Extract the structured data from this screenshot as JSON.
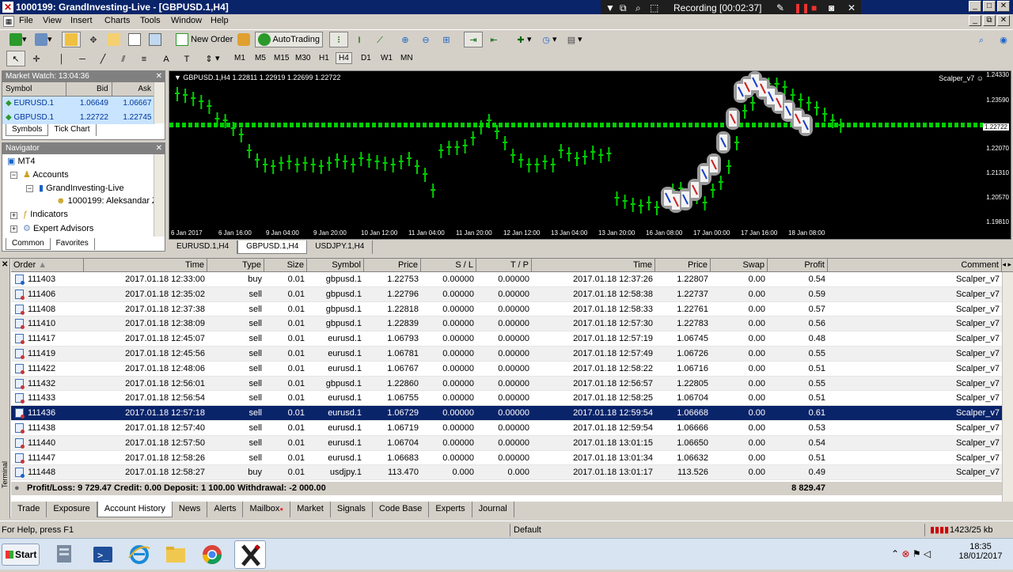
{
  "window": {
    "title": "1000199: GrandInvesting-Live - [GBPUSD.1,H4]"
  },
  "recorder": {
    "label": "Recording [00:02:37]"
  },
  "menu": [
    "File",
    "View",
    "Insert",
    "Charts",
    "Tools",
    "Window",
    "Help"
  ],
  "toolbar": {
    "new_order": "New Order",
    "autotrading": "AutoTrading"
  },
  "timeframes": [
    "M1",
    "M5",
    "M15",
    "M30",
    "H1",
    "H4",
    "D1",
    "W1",
    "MN"
  ],
  "timeframe_active": "H4",
  "market_watch": {
    "title": "Market Watch: 13:04:36",
    "headers": {
      "symbol": "Symbol",
      "bid": "Bid",
      "ask": "Ask"
    },
    "rows": [
      {
        "symbol": "EURUSD.1",
        "bid": "1.06649",
        "ask": "1.06667"
      },
      {
        "symbol": "GBPUSD.1",
        "bid": "1.22722",
        "ask": "1.22745"
      }
    ],
    "tabs": [
      "Symbols",
      "Tick Chart"
    ]
  },
  "navigator": {
    "title": "Navigator",
    "items": {
      "root": "MT4",
      "accounts": "Accounts",
      "server": "GrandInvesting-Live",
      "account": "1000199: Aleksandar Z",
      "indicators": "Indicators",
      "experts": "Expert Advisors"
    },
    "tabs": [
      "Common",
      "Favorites"
    ]
  },
  "chart": {
    "ohlc_label": "GBPUSD.1,H4  1.22811 1.22919 1.22699 1.22722",
    "ea_label": "Scalper_v7",
    "price_labels": [
      "1.24330",
      "1.23590",
      "1.22722",
      "1.22070",
      "1.21310",
      "1.20570",
      "1.19810"
    ],
    "time_labels": [
      "6 Jan 2017",
      "6 Jan 16:00",
      "9 Jan 04:00",
      "9 Jan 20:00",
      "10 Jan 12:00",
      "11 Jan 04:00",
      "11 Jan 20:00",
      "12 Jan 12:00",
      "13 Jan 04:00",
      "13 Jan 20:00",
      "16 Jan 08:00",
      "17 Jan 00:00",
      "17 Jan 16:00",
      "18 Jan 08:00"
    ],
    "tabs": [
      "EURUSD.1,H4",
      "GBPUSD.1,H4",
      "USDJPY.1,H4"
    ],
    "active_tab": "GBPUSD.1,H4"
  },
  "terminal": {
    "side_label": "Terminal",
    "headers": [
      "Order",
      "Time",
      "Type",
      "Size",
      "Symbol",
      "Price",
      "S / L",
      "T / P",
      "Time",
      "Price",
      "Swap",
      "Profit",
      "Comment"
    ],
    "rows": [
      [
        "111403",
        "2017.01.18 12:33:00",
        "buy",
        "0.01",
        "gbpusd.1",
        "1.22753",
        "0.00000",
        "0.00000",
        "2017.01.18 12:37:26",
        "1.22807",
        "0.00",
        "0.54",
        "Scalper_v7"
      ],
      [
        "111406",
        "2017.01.18 12:35:02",
        "sell",
        "0.01",
        "gbpusd.1",
        "1.22796",
        "0.00000",
        "0.00000",
        "2017.01.18 12:58:38",
        "1.22737",
        "0.00",
        "0.59",
        "Scalper_v7"
      ],
      [
        "111408",
        "2017.01.18 12:37:38",
        "sell",
        "0.01",
        "gbpusd.1",
        "1.22818",
        "0.00000",
        "0.00000",
        "2017.01.18 12:58:33",
        "1.22761",
        "0.00",
        "0.57",
        "Scalper_v7"
      ],
      [
        "111410",
        "2017.01.18 12:38:09",
        "sell",
        "0.01",
        "gbpusd.1",
        "1.22839",
        "0.00000",
        "0.00000",
        "2017.01.18 12:57:30",
        "1.22783",
        "0.00",
        "0.56",
        "Scalper_v7"
      ],
      [
        "111417",
        "2017.01.18 12:45:07",
        "sell",
        "0.01",
        "eurusd.1",
        "1.06793",
        "0.00000",
        "0.00000",
        "2017.01.18 12:57:19",
        "1.06745",
        "0.00",
        "0.48",
        "Scalper_v7"
      ],
      [
        "111419",
        "2017.01.18 12:45:56",
        "sell",
        "0.01",
        "eurusd.1",
        "1.06781",
        "0.00000",
        "0.00000",
        "2017.01.18 12:57:49",
        "1.06726",
        "0.00",
        "0.55",
        "Scalper_v7"
      ],
      [
        "111422",
        "2017.01.18 12:48:06",
        "sell",
        "0.01",
        "eurusd.1",
        "1.06767",
        "0.00000",
        "0.00000",
        "2017.01.18 12:58:22",
        "1.06716",
        "0.00",
        "0.51",
        "Scalper_v7"
      ],
      [
        "111432",
        "2017.01.18 12:56:01",
        "sell",
        "0.01",
        "gbpusd.1",
        "1.22860",
        "0.00000",
        "0.00000",
        "2017.01.18 12:56:57",
        "1.22805",
        "0.00",
        "0.55",
        "Scalper_v7"
      ],
      [
        "111433",
        "2017.01.18 12:56:54",
        "sell",
        "0.01",
        "eurusd.1",
        "1.06755",
        "0.00000",
        "0.00000",
        "2017.01.18 12:58:25",
        "1.06704",
        "0.00",
        "0.51",
        "Scalper_v7"
      ],
      [
        "111436",
        "2017.01.18 12:57:18",
        "sell",
        "0.01",
        "eurusd.1",
        "1.06729",
        "0.00000",
        "0.00000",
        "2017.01.18 12:59:54",
        "1.06668",
        "0.00",
        "0.61",
        "Scalper_v7"
      ],
      [
        "111438",
        "2017.01.18 12:57:40",
        "sell",
        "0.01",
        "eurusd.1",
        "1.06719",
        "0.00000",
        "0.00000",
        "2017.01.18 12:59:54",
        "1.06666",
        "0.00",
        "0.53",
        "Scalper_v7"
      ],
      [
        "111440",
        "2017.01.18 12:57:50",
        "sell",
        "0.01",
        "eurusd.1",
        "1.06704",
        "0.00000",
        "0.00000",
        "2017.01.18 13:01:15",
        "1.06650",
        "0.00",
        "0.54",
        "Scalper_v7"
      ],
      [
        "111447",
        "2017.01.18 12:58:26",
        "sell",
        "0.01",
        "eurusd.1",
        "1.06683",
        "0.00000",
        "0.00000",
        "2017.01.18 13:01:34",
        "1.06632",
        "0.00",
        "0.51",
        "Scalper_v7"
      ],
      [
        "111448",
        "2017.01.18 12:58:27",
        "buy",
        "0.01",
        "usdjpy.1",
        "113.470",
        "0.000",
        "0.000",
        "2017.01.18 13:01:17",
        "113.526",
        "0.00",
        "0.49",
        "Scalper_v7"
      ]
    ],
    "selected_row": 9,
    "summary": "Profit/Loss: 9 729.47  Credit: 0.00  Deposit: 1 100.00  Withdrawal: -2 000.00",
    "summary_total": "8 829.47",
    "tabs": [
      "Trade",
      "Exposure",
      "Account History",
      "News",
      "Alerts",
      "Mailbox",
      "Market",
      "Signals",
      "Code Base",
      "Experts",
      "Journal"
    ],
    "active_tab": "Account History"
  },
  "status": {
    "help": "For Help, press F1",
    "profile": "Default",
    "traffic": "1423/25 kb"
  },
  "taskbar": {
    "start": "Start",
    "time": "18:35",
    "date": "18/01/2017"
  },
  "colors": {
    "bull": "#00d000",
    "bear": "#00d000",
    "chart_bg": "#000000",
    "selection": "#0a246a"
  }
}
